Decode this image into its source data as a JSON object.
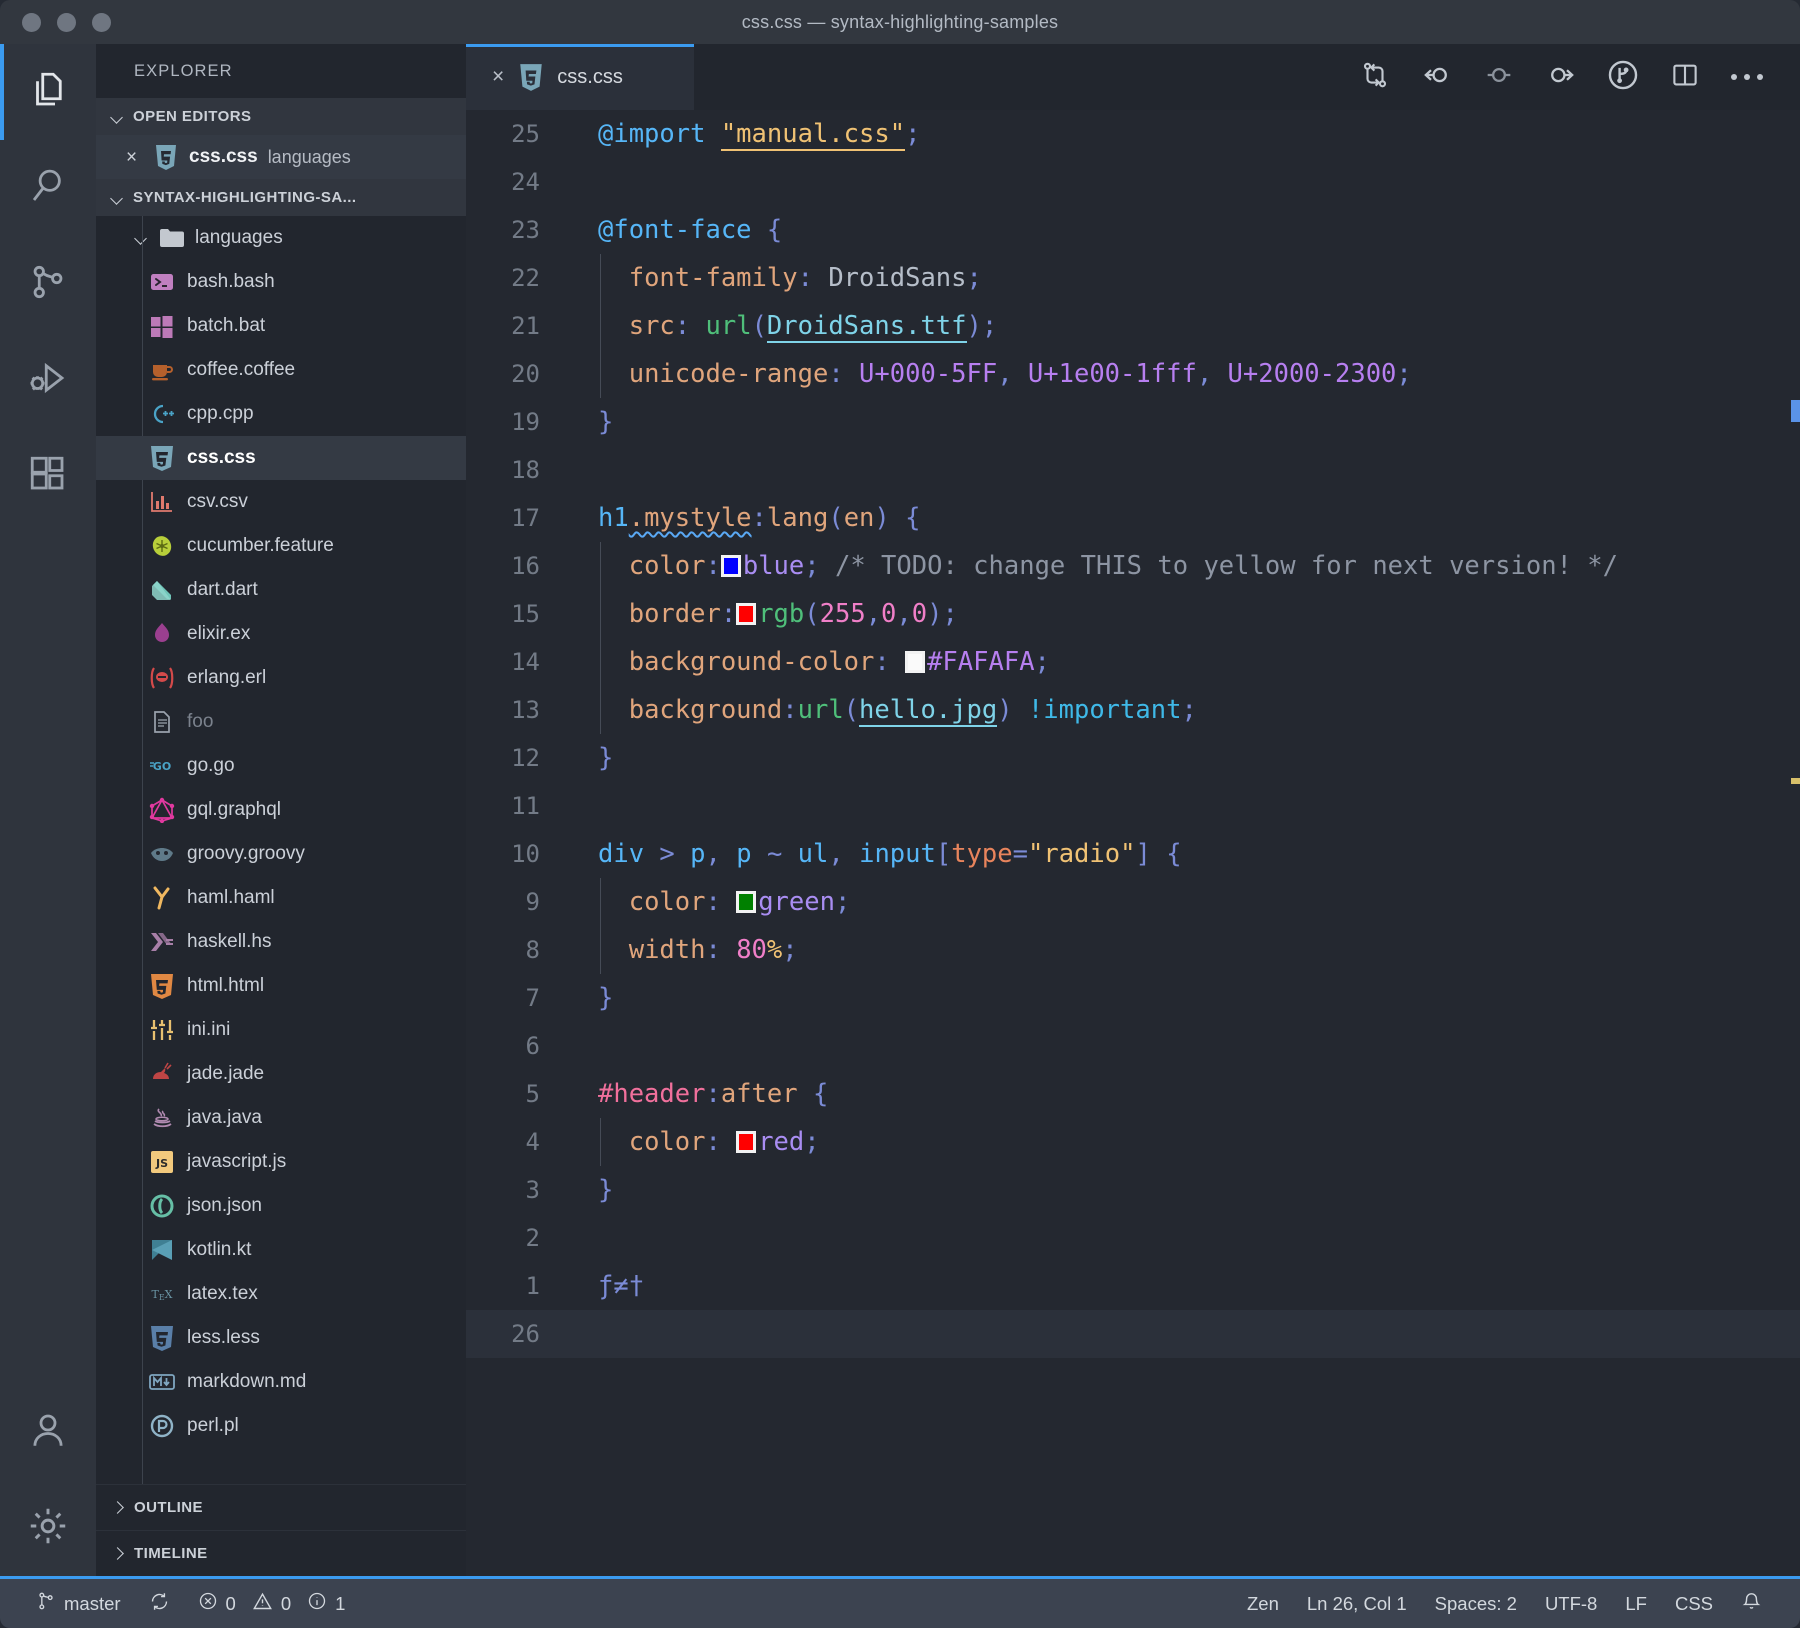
{
  "window": {
    "title": "css.css — syntax-highlighting-samples",
    "traffic_lights": [
      "close",
      "minimize",
      "maximize"
    ]
  },
  "activitybar": {
    "items": [
      {
        "name": "explorer",
        "icon": "files-icon",
        "active": true
      },
      {
        "name": "search",
        "icon": "search-icon",
        "active": false
      },
      {
        "name": "source-control",
        "icon": "source-control-icon",
        "active": false
      },
      {
        "name": "run-and-debug",
        "icon": "run-debug-icon",
        "active": false
      },
      {
        "name": "extensions",
        "icon": "extensions-icon",
        "active": false
      }
    ],
    "bottom": [
      {
        "name": "accounts",
        "icon": "account-icon"
      },
      {
        "name": "settings",
        "icon": "gear-icon"
      }
    ]
  },
  "sidebar": {
    "title": "EXPLORER",
    "open_editors": {
      "label": "OPEN EDITORS",
      "expanded": true,
      "items": [
        {
          "name": "css.css",
          "dir": "languages",
          "icon": "css-icon",
          "close": "×",
          "active": true
        }
      ]
    },
    "workspace": {
      "label": "SYNTAX-HIGHLIGHTING-SA...",
      "expanded": true
    },
    "folder": {
      "label": "languages",
      "icon": "folder-icon",
      "expanded": true
    },
    "files": [
      {
        "label": "bash.bash",
        "icon": "bash-icon",
        "selected": false,
        "dim": false
      },
      {
        "label": "batch.bat",
        "icon": "batch-icon",
        "selected": false,
        "dim": false
      },
      {
        "label": "coffee.coffee",
        "icon": "coffee-icon",
        "selected": false,
        "dim": false
      },
      {
        "label": "cpp.cpp",
        "icon": "cpp-icon",
        "selected": false,
        "dim": false
      },
      {
        "label": "css.css",
        "icon": "css-icon",
        "selected": true,
        "dim": false
      },
      {
        "label": "csv.csv",
        "icon": "csv-icon",
        "selected": false,
        "dim": false
      },
      {
        "label": "cucumber.feature",
        "icon": "cucumber-icon",
        "selected": false,
        "dim": false
      },
      {
        "label": "dart.dart",
        "icon": "dart-icon",
        "selected": false,
        "dim": false
      },
      {
        "label": "elixir.ex",
        "icon": "elixir-icon",
        "selected": false,
        "dim": false
      },
      {
        "label": "erlang.erl",
        "icon": "erlang-icon",
        "selected": false,
        "dim": false
      },
      {
        "label": "foo",
        "icon": "file-icon",
        "selected": false,
        "dim": true
      },
      {
        "label": "go.go",
        "icon": "go-icon",
        "selected": false,
        "dim": false
      },
      {
        "label": "gql.graphql",
        "icon": "graphql-icon",
        "selected": false,
        "dim": false
      },
      {
        "label": "groovy.groovy",
        "icon": "groovy-icon",
        "selected": false,
        "dim": false
      },
      {
        "label": "haml.haml",
        "icon": "haml-icon",
        "selected": false,
        "dim": false
      },
      {
        "label": "haskell.hs",
        "icon": "haskell-icon",
        "selected": false,
        "dim": false
      },
      {
        "label": "html.html",
        "icon": "html-icon",
        "selected": false,
        "dim": false
      },
      {
        "label": "ini.ini",
        "icon": "ini-icon",
        "selected": false,
        "dim": false
      },
      {
        "label": "jade.jade",
        "icon": "jade-icon",
        "selected": false,
        "dim": false
      },
      {
        "label": "java.java",
        "icon": "java-icon",
        "selected": false,
        "dim": false
      },
      {
        "label": "javascript.js",
        "icon": "js-icon",
        "selected": false,
        "dim": false
      },
      {
        "label": "json.json",
        "icon": "json-icon",
        "selected": false,
        "dim": false
      },
      {
        "label": "kotlin.kt",
        "icon": "kotlin-icon",
        "selected": false,
        "dim": false
      },
      {
        "label": "latex.tex",
        "icon": "latex-icon",
        "selected": false,
        "dim": false
      },
      {
        "label": "less.less",
        "icon": "less-icon",
        "selected": false,
        "dim": false
      },
      {
        "label": "markdown.md",
        "icon": "markdown-icon",
        "selected": false,
        "dim": false
      },
      {
        "label": "perl.pl",
        "icon": "perl-icon",
        "selected": false,
        "dim": false
      }
    ],
    "outline": {
      "label": "OUTLINE",
      "expanded": false
    },
    "timeline": {
      "label": "TIMELINE",
      "expanded": false
    }
  },
  "editor": {
    "tab": {
      "label": "css.css",
      "icon": "css-icon",
      "close": "×",
      "active": true
    },
    "toolbar": [
      {
        "name": "compare-changes",
        "icon": "compare-changes-icon"
      },
      {
        "name": "previous-change",
        "icon": "previous-change-icon"
      },
      {
        "name": "current-change",
        "icon": "current-change-icon"
      },
      {
        "name": "next-change",
        "icon": "next-change-icon"
      },
      {
        "name": "git-graph",
        "icon": "git-graph-icon"
      },
      {
        "name": "split-editor",
        "icon": "split-editor-icon"
      },
      {
        "name": "more-actions",
        "icon": "more-actions-icon"
      }
    ],
    "language": "CSS",
    "lines": [
      {
        "num": "25",
        "current": false
      },
      {
        "num": "24",
        "current": false
      },
      {
        "num": "23",
        "current": false
      },
      {
        "num": "22",
        "current": false
      },
      {
        "num": "21",
        "current": false
      },
      {
        "num": "20",
        "current": false
      },
      {
        "num": "19",
        "current": false
      },
      {
        "num": "18",
        "current": false
      },
      {
        "num": "17",
        "current": false
      },
      {
        "num": "16",
        "current": false
      },
      {
        "num": "15",
        "current": false
      },
      {
        "num": "14",
        "current": false
      },
      {
        "num": "13",
        "current": false
      },
      {
        "num": "12",
        "current": false
      },
      {
        "num": "11",
        "current": false
      },
      {
        "num": "10",
        "current": false
      },
      {
        "num": "9",
        "current": false
      },
      {
        "num": "8",
        "current": false
      },
      {
        "num": "7",
        "current": false
      },
      {
        "num": "6",
        "current": false
      },
      {
        "num": "5",
        "current": false
      },
      {
        "num": "4",
        "current": false
      },
      {
        "num": "3",
        "current": false
      },
      {
        "num": "2",
        "current": false
      },
      {
        "num": "1",
        "current": false
      },
      {
        "num": "26",
        "current": true
      }
    ],
    "source_text": [
      "@import \"manual.css\";",
      "",
      "@font-face {",
      "  font-family: DroidSans;",
      "  src: url(DroidSans.ttf);",
      "  unicode-range: U+000-5FF, U+1e00-1fff, U+2000-2300;",
      "}",
      "",
      "h1.mystyle:lang(en) {",
      "  color:■blue; /* TODO: change THIS to yellow for next version! */",
      "  border:■rgb(255,0,0);",
      "  background-color: □#FAFAFA;",
      "  background:url(hello.jpg) !important;",
      "}",
      "",
      "div > p, p ~ ul, input[type=\"radio\"] {",
      "  color: ■green;",
      "  width: 80%;",
      "}",
      "",
      "#header:after {",
      "  color: ■red;",
      "}",
      "",
      "ƒ≠†",
      ""
    ],
    "color_swatches": [
      {
        "line": "16",
        "value": "blue",
        "hex": "#0000ff"
      },
      {
        "line": "15",
        "value": "rgb(255,0,0)",
        "hex": "#ff0000"
      },
      {
        "line": "14",
        "value": "#FAFAFA",
        "hex": "#fafafa"
      },
      {
        "line": "9",
        "value": "green",
        "hex": "#008000"
      },
      {
        "line": "4",
        "value": "red",
        "hex": "#ff0000"
      }
    ]
  },
  "statusbar": {
    "branch": "master",
    "sync_icon": "sync-icon",
    "errors_icon": "error-icon",
    "errors": "0",
    "warnings_icon": "warning-icon",
    "warnings": "0",
    "info_icon": "info-icon",
    "info": "1",
    "zen": "Zen",
    "cursor": "Ln 26, Col 1",
    "spaces": "Spaces: 2",
    "encoding": "UTF-8",
    "eol": "LF",
    "language": "CSS",
    "bell_icon": "bell-icon"
  },
  "colors": {
    "accent": "#3b9bf0",
    "titlebar": "#32373f",
    "sidebar": "#22262e",
    "editor": "#242830",
    "statusbar": "#3c4350"
  }
}
